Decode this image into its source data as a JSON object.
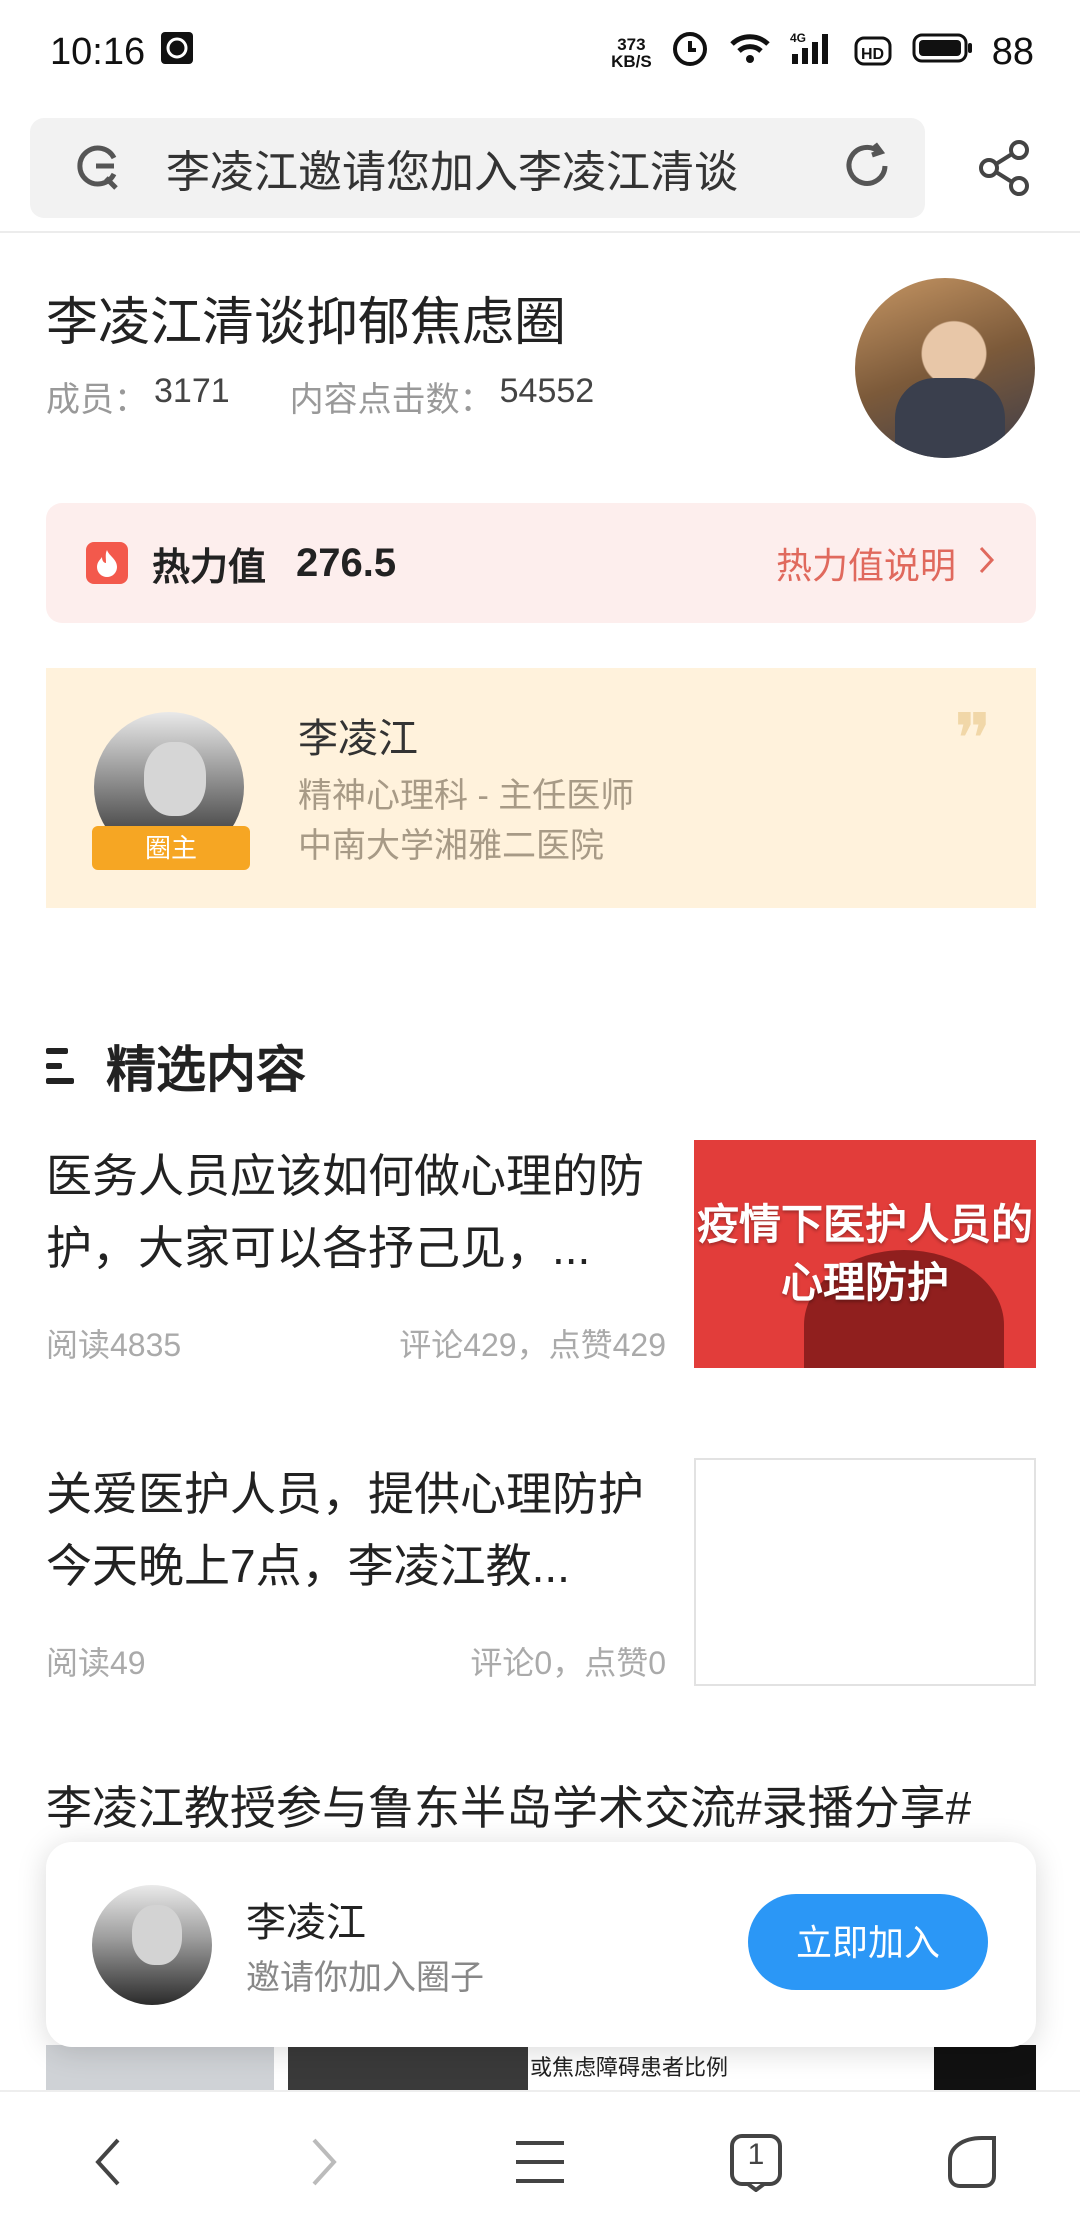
{
  "status_bar": {
    "time": "10:16",
    "net_speed_value": "373",
    "net_speed_unit": "KB/S",
    "network": "4G",
    "hd": "HD",
    "battery": "88"
  },
  "address_bar": {
    "text": "李凌江邀请您加入李凌江清谈",
    "icons": [
      "search-engine-icon",
      "refresh-icon",
      "share-icon"
    ]
  },
  "circle": {
    "title": "李凌江清谈抑郁焦虑圈",
    "members_label": "成员：",
    "members_value": "3171",
    "clicks_label": "内容点击数：",
    "clicks_value": "54552"
  },
  "heat": {
    "label": "热力值",
    "value": "276.5",
    "explain": "热力值说明"
  },
  "owner": {
    "badge": "圈主",
    "name": "李凌江",
    "title": "精神心理科 - 主任医师",
    "hospital": "中南大学湘雅二医院"
  },
  "section": {
    "title": "精选内容"
  },
  "articles": [
    {
      "title": "医务人员应该如何做心理的防护，大家可以各抒己见，...",
      "reads": "阅读4835",
      "stats": "评论429，点赞429",
      "thumb_line1": "疫情下医护人员的",
      "thumb_line2": "心理防护"
    },
    {
      "title": "关爱医护人员，提供心理防护 今天晚上7点，李凌江教...",
      "reads": "阅读49",
      "stats": "评论0，点赞0"
    },
    {
      "title": "李凌江教授参与鲁东半岛学术交流#录播分享#"
    }
  ],
  "strip_caption": "或焦虑障碍患者比例",
  "invite": {
    "name": "李凌江",
    "subtitle": "邀请你加入圈子",
    "button": "立即加入"
  },
  "bottom_nav": {
    "tab_count": "1",
    "items": [
      "back-icon",
      "forward-icon",
      "menu-icon",
      "tabs-icon",
      "home-icon"
    ]
  },
  "colors": {
    "accent_blue": "#2b97f6",
    "heat_red": "#f3594c",
    "heat_bg": "#fdeeed",
    "owner_bg": "#fff2dc",
    "thumb_red": "#e23d3a"
  }
}
